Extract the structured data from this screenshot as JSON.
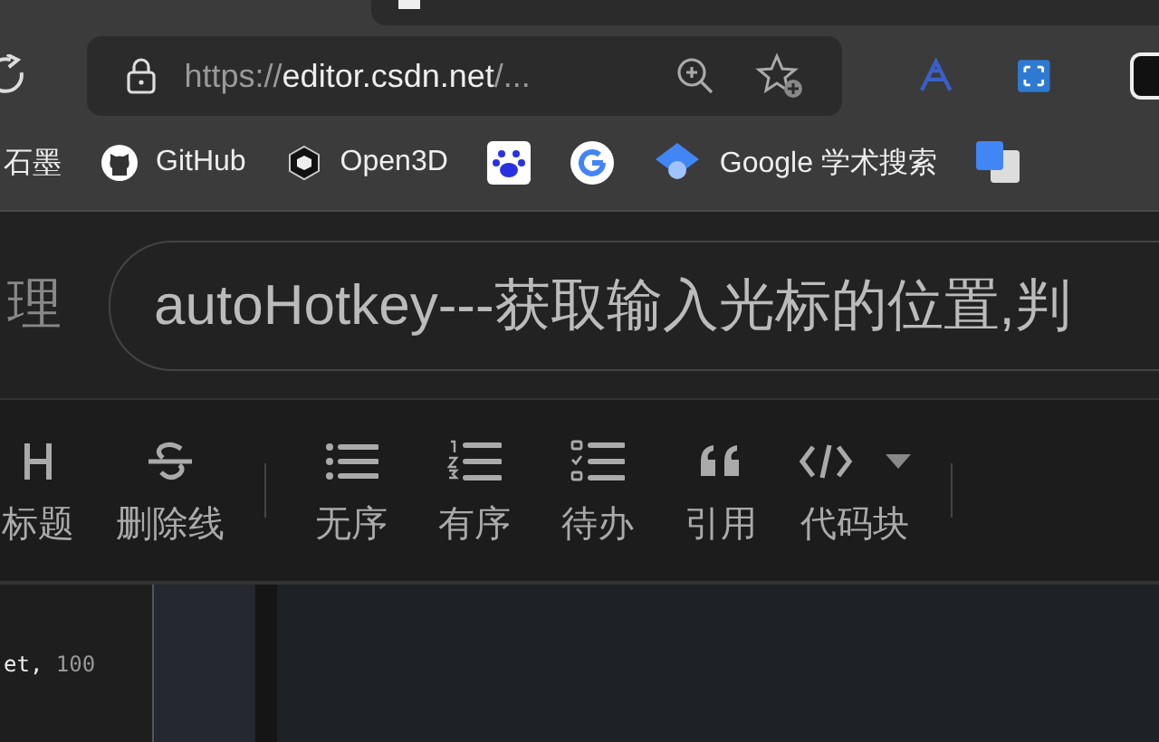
{
  "browser": {
    "url_dim": "https://",
    "url_host": "editor.csdn.net",
    "url_rest": "/...",
    "bookmarks": [
      {
        "label": "石墨",
        "kind": "text"
      },
      {
        "label": "GitHub",
        "kind": "github"
      },
      {
        "label": "Open3D",
        "kind": "open3d"
      },
      {
        "kind": "baidu"
      },
      {
        "kind": "google"
      },
      {
        "label": "Google 学术搜索",
        "kind": "scholar"
      },
      {
        "kind": "translate"
      }
    ]
  },
  "editor": {
    "section_label": "理",
    "title": "autoHotkey---获取输入光标的位置,判",
    "toolbar": [
      {
        "label": "标题",
        "kind": "heading"
      },
      {
        "label": "删除线",
        "kind": "strike"
      },
      {
        "kind": "separator"
      },
      {
        "label": "无序",
        "kind": "bullets"
      },
      {
        "label": "有序",
        "kind": "numbers"
      },
      {
        "label": "待办",
        "kind": "todo"
      },
      {
        "label": "引用",
        "kind": "quote"
      },
      {
        "label": "代码块",
        "kind": "code",
        "dropdown": true
      },
      {
        "kind": "separator"
      }
    ],
    "code_text": "et,",
    "code_number": "100"
  }
}
